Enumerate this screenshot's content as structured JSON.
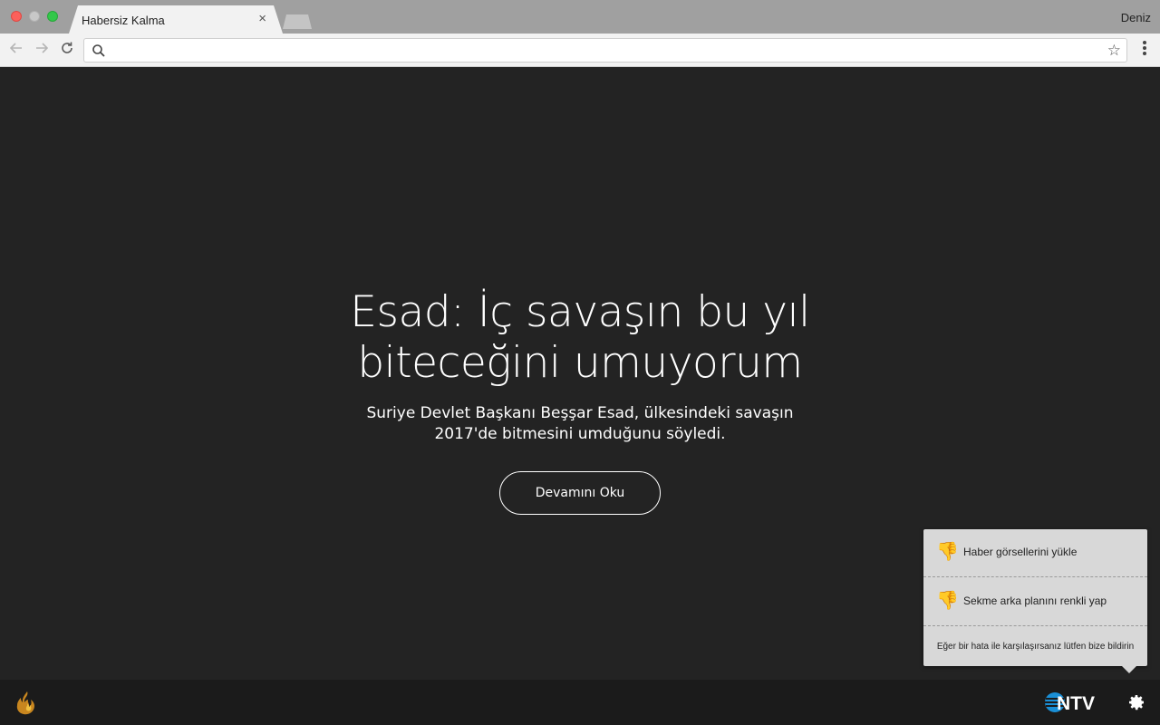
{
  "browser": {
    "tab_title": "Habersiz Kalma",
    "tab_close": "×",
    "user_name": "Deniz",
    "address_value": "",
    "address_placeholder": ""
  },
  "article": {
    "headline": "Esad: İç savaşın bu yıl biteceğini umuyorum",
    "summary": "Suriye Devlet Başkanı Beşşar Esad, ülkesindeki savaşın 2017'de bitmesini umduğunu söyledi.",
    "read_more_label": "Devamını Oku"
  },
  "settings_popover": {
    "items": [
      {
        "label": "Haber görsellerini yükle",
        "icon": "thumbs-down-icon"
      },
      {
        "label": "Sekme arka planını renkli yap",
        "icon": "thumbs-down-icon"
      }
    ],
    "report_label": "Eğer bir hata ile karşılaşırsanız lütfen bize bildirin"
  },
  "footer": {
    "left_icon": "fire-icon",
    "brand_logo": "NTV",
    "settings_icon": "gear-icon"
  },
  "colors": {
    "page_background": "#232323",
    "footer_background": "#1b1b1b",
    "popover_background": "#d8d8d8",
    "ntv_blue": "#1a8fd6"
  }
}
